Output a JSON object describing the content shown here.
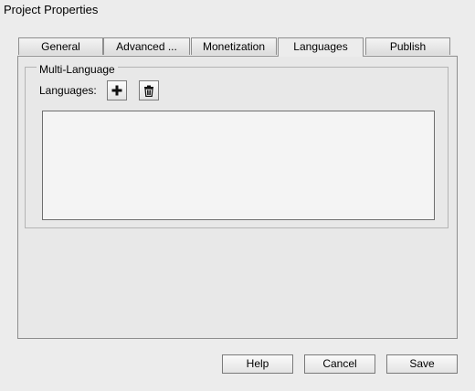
{
  "window": {
    "title": "Project Properties"
  },
  "tabs": [
    {
      "label": "General",
      "active": false
    },
    {
      "label": "Advanced ...",
      "active": false
    },
    {
      "label": "Monetization",
      "active": false
    },
    {
      "label": "Languages",
      "active": true
    },
    {
      "label": "Publish",
      "active": false
    }
  ],
  "multi_language": {
    "group_title": "Multi-Language",
    "languages_label": "Languages:",
    "add_icon": "plus-icon",
    "delete_icon": "trash-icon",
    "languages": []
  },
  "footer": {
    "help_label": "Help",
    "cancel_label": "Cancel",
    "save_label": "Save"
  }
}
